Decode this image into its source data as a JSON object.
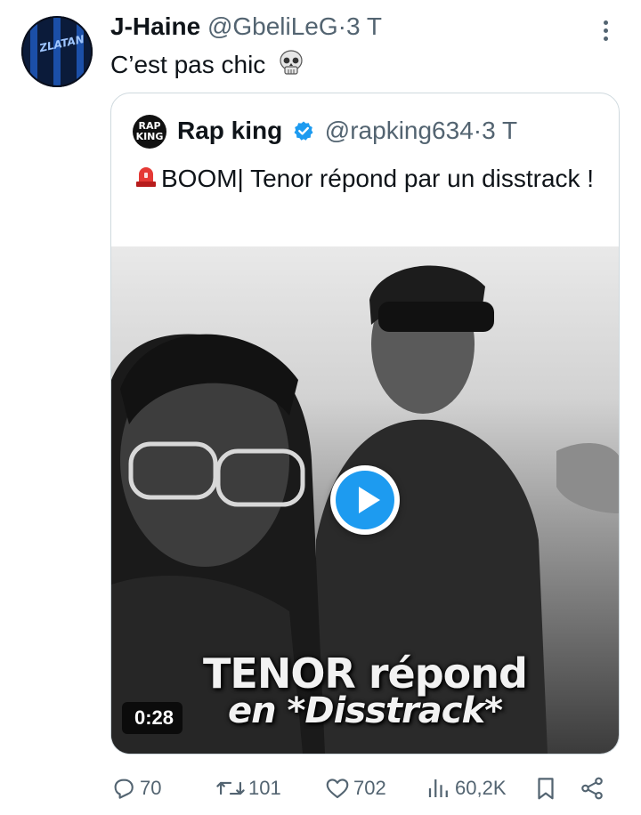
{
  "tweet": {
    "author_name": "J-Haine",
    "author_handle": "@GbeliLeG",
    "separator": "·",
    "time": "3 T",
    "text": "C’est pas chic",
    "emoji": "skull-emoji",
    "avatar_text": "ZLATAN"
  },
  "quote": {
    "author_name": "Rap king",
    "author_handle": "@rapking634",
    "separator": "·",
    "time": "3 T",
    "avatar_label": "RAP KING",
    "text": "BOOM| Tenor répond par un disstrack !",
    "emoji": "police-light-emoji",
    "verified": true,
    "media": {
      "type": "video",
      "overlay_line1": "TENOR répond",
      "overlay_line2": "en *Disstrack*",
      "duration": "0:28"
    }
  },
  "actions": {
    "replies": "70",
    "reposts": "101",
    "likes": "702",
    "views": "60,2K"
  },
  "colors": {
    "accent": "#1d9bf0",
    "text_primary": "#0f1419",
    "text_secondary": "#536471",
    "border": "#cfd9de"
  }
}
